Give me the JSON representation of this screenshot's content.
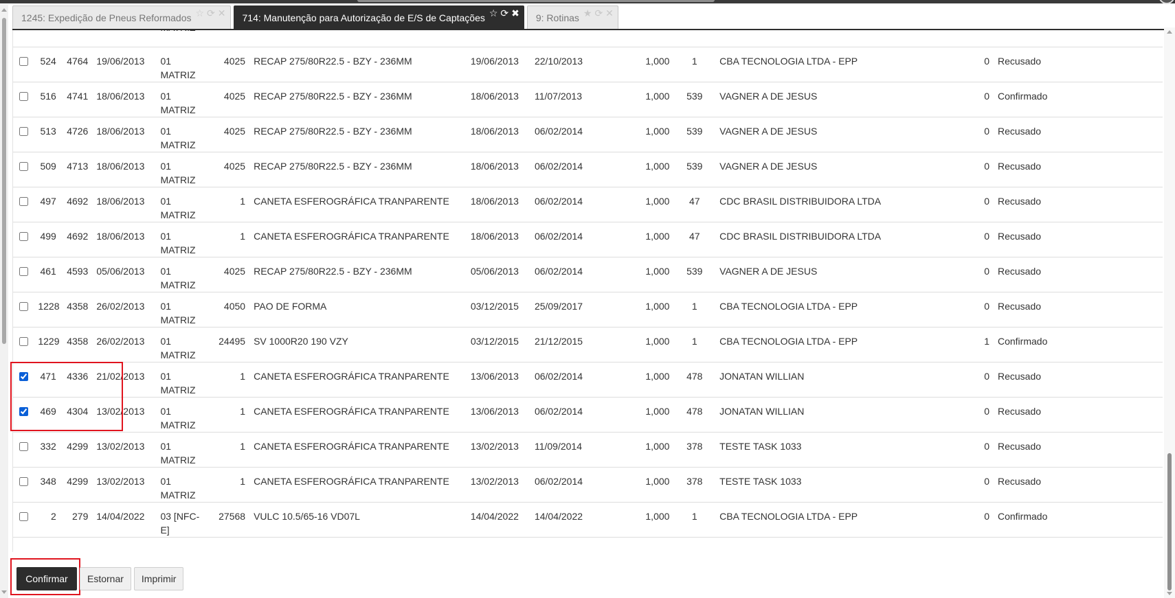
{
  "tabs": [
    {
      "label": "1245: Expedição de Pneus Reformados",
      "active": false
    },
    {
      "label": "714: Manutenção para Autorização de E/S de Captações",
      "active": true
    },
    {
      "label": "9: Rotinas",
      "active": false
    }
  ],
  "tab_icons": [
    "star-icon",
    "refresh-icon",
    "close-icon"
  ],
  "first_row_partial": {
    "filial_line2": "MATRIZ"
  },
  "rows": [
    {
      "checked": false,
      "id": "524",
      "doc": "4764",
      "data": "19/06/2013",
      "filial": "01 MATRIZ",
      "cod": "4025",
      "produto": "RECAP 275/80R22.5 - BZY - 236MM",
      "data2": "19/06/2013",
      "data3": "22/10/2013",
      "qtd": "1,000",
      "cod2": "1",
      "cliente": "CBA TECNOLOGIA LTDA - EPP",
      "n": "0",
      "status": "Recusado"
    },
    {
      "checked": false,
      "id": "516",
      "doc": "4741",
      "data": "18/06/2013",
      "filial": "01 MATRIZ",
      "cod": "4025",
      "produto": "RECAP 275/80R22.5 - BZY - 236MM",
      "data2": "18/06/2013",
      "data3": "11/07/2013",
      "qtd": "1,000",
      "cod2": "539",
      "cliente": "VAGNER A DE JESUS",
      "n": "0",
      "status": "Confirmado"
    },
    {
      "checked": false,
      "id": "513",
      "doc": "4726",
      "data": "18/06/2013",
      "filial": "01 MATRIZ",
      "cod": "4025",
      "produto": "RECAP 275/80R22.5 - BZY - 236MM",
      "data2": "18/06/2013",
      "data3": "06/02/2014",
      "qtd": "1,000",
      "cod2": "539",
      "cliente": "VAGNER A DE JESUS",
      "n": "0",
      "status": "Recusado"
    },
    {
      "checked": false,
      "id": "509",
      "doc": "4713",
      "data": "18/06/2013",
      "filial": "01 MATRIZ",
      "cod": "4025",
      "produto": "RECAP 275/80R22.5 - BZY - 236MM",
      "data2": "18/06/2013",
      "data3": "06/02/2014",
      "qtd": "1,000",
      "cod2": "539",
      "cliente": "VAGNER A DE JESUS",
      "n": "0",
      "status": "Recusado"
    },
    {
      "checked": false,
      "id": "497",
      "doc": "4692",
      "data": "18/06/2013",
      "filial": "01 MATRIZ",
      "cod": "1",
      "produto": "CANETA ESFEROGRÁFICA TRANPARENTE",
      "data2": "18/06/2013",
      "data3": "06/02/2014",
      "qtd": "1,000",
      "cod2": "47",
      "cliente": "CDC BRASIL DISTRIBUIDORA LTDA",
      "n": "0",
      "status": "Recusado"
    },
    {
      "checked": false,
      "id": "499",
      "doc": "4692",
      "data": "18/06/2013",
      "filial": "01 MATRIZ",
      "cod": "1",
      "produto": "CANETA ESFEROGRÁFICA TRANPARENTE",
      "data2": "18/06/2013",
      "data3": "06/02/2014",
      "qtd": "1,000",
      "cod2": "47",
      "cliente": "CDC BRASIL DISTRIBUIDORA LTDA",
      "n": "0",
      "status": "Recusado"
    },
    {
      "checked": false,
      "id": "461",
      "doc": "4593",
      "data": "05/06/2013",
      "filial": "01 MATRIZ",
      "cod": "4025",
      "produto": "RECAP 275/80R22.5 - BZY - 236MM",
      "data2": "05/06/2013",
      "data3": "06/02/2014",
      "qtd": "1,000",
      "cod2": "539",
      "cliente": "VAGNER A DE JESUS",
      "n": "0",
      "status": "Recusado"
    },
    {
      "checked": false,
      "id": "1228",
      "doc": "4358",
      "data": "26/02/2013",
      "filial": "01 MATRIZ",
      "cod": "4050",
      "produto": "PAO DE FORMA",
      "data2": "03/12/2015",
      "data3": "25/09/2017",
      "qtd": "1,000",
      "cod2": "1",
      "cliente": "CBA TECNOLOGIA LTDA - EPP",
      "n": "0",
      "status": "Recusado"
    },
    {
      "checked": false,
      "id": "1229",
      "doc": "4358",
      "data": "26/02/2013",
      "filial": "01 MATRIZ",
      "cod": "24495",
      "produto": "SV 1000R20 190 VZY",
      "data2": "03/12/2015",
      "data3": "21/12/2015",
      "qtd": "1,000",
      "cod2": "1",
      "cliente": "CBA TECNOLOGIA LTDA - EPP",
      "n": "1",
      "status": "Confirmado"
    },
    {
      "checked": true,
      "id": "471",
      "doc": "4336",
      "data": "21/02/2013",
      "filial": "01 MATRIZ",
      "cod": "1",
      "produto": "CANETA ESFEROGRÁFICA TRANPARENTE",
      "data2": "13/06/2013",
      "data3": "06/02/2014",
      "qtd": "1,000",
      "cod2": "478",
      "cliente": "JONATAN WILLIAN",
      "n": "0",
      "status": "Recusado"
    },
    {
      "checked": true,
      "id": "469",
      "doc": "4304",
      "data": "13/02/2013",
      "filial": "01 MATRIZ",
      "cod": "1",
      "produto": "CANETA ESFEROGRÁFICA TRANPARENTE",
      "data2": "13/06/2013",
      "data3": "06/02/2014",
      "qtd": "1,000",
      "cod2": "478",
      "cliente": "JONATAN WILLIAN",
      "n": "0",
      "status": "Recusado"
    },
    {
      "checked": false,
      "id": "332",
      "doc": "4299",
      "data": "13/02/2013",
      "filial": "01 MATRIZ",
      "cod": "1",
      "produto": "CANETA ESFEROGRÁFICA TRANPARENTE",
      "data2": "13/02/2013",
      "data3": "11/09/2014",
      "qtd": "1,000",
      "cod2": "378",
      "cliente": "TESTE TASK 1033",
      "n": "0",
      "status": "Recusado"
    },
    {
      "checked": false,
      "id": "348",
      "doc": "4299",
      "data": "13/02/2013",
      "filial": "01 MATRIZ",
      "cod": "1",
      "produto": "CANETA ESFEROGRÁFICA TRANPARENTE",
      "data2": "13/02/2013",
      "data3": "06/02/2014",
      "qtd": "1,000",
      "cod2": "378",
      "cliente": "TESTE TASK 1033",
      "n": "0",
      "status": "Recusado"
    },
    {
      "checked": false,
      "id": "2",
      "doc": "279",
      "data": "14/04/2022",
      "filial": "03 [NFC-E]",
      "cod": "27568",
      "produto": "VULC 10.5/65-16 VD07L",
      "data2": "14/04/2022",
      "data3": "14/04/2022",
      "qtd": "1,000",
      "cod2": "1",
      "cliente": "CBA TECNOLOGIA LTDA - EPP",
      "n": "0",
      "status": "Confirmado"
    }
  ],
  "buttons": {
    "confirm": "Confirmar",
    "reverse": "Estornar",
    "print": "Imprimir"
  },
  "colors": {
    "accent": "#2d2d2d",
    "highlight": "#e0141e",
    "checkbox": "#0a5fd7"
  }
}
